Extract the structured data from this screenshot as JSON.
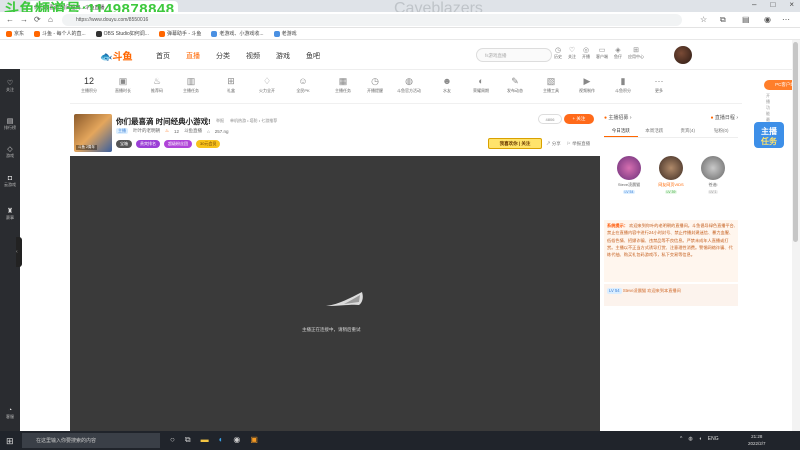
{
  "overlay": {
    "room_id": "斗鱼频道号:1149878848",
    "game_name": "Caveblazers"
  },
  "browser": {
    "tab_title": "你们最喜滴 时间经典...斗鱼直播",
    "url": "https://www.douyu.com/8550016",
    "bookmarks": [
      "京东",
      "斗鱼 - 每个人的直...",
      "OBS Studio如何调...",
      "弹幕助手 - 斗鱼",
      "老游戏、小游戏收...",
      "老游戏"
    ]
  },
  "header": {
    "nav": [
      "首页",
      "直播",
      "分类",
      "视频",
      "游戏",
      "鱼吧"
    ],
    "active_nav": "直播",
    "search_placeholder": "fs游戏直播",
    "icons": [
      {
        "label": "历史",
        "icon": "history-icon"
      },
      {
        "label": "关注",
        "icon": "follow-icon"
      },
      {
        "label": "开播",
        "icon": "broadcast-icon"
      },
      {
        "label": "客户端",
        "icon": "client-icon"
      },
      {
        "label": "鱼仔",
        "icon": "fish-icon"
      },
      {
        "label": "应用中心",
        "icon": "app-center-icon"
      }
    ]
  },
  "sidebar": [
    {
      "label": "关注",
      "icon": "heart-icon"
    },
    {
      "label": "排行榜",
      "icon": "ranking-icon"
    },
    {
      "label": "游戏",
      "icon": "game-icon"
    },
    {
      "label": "云游戏",
      "icon": "cloud-game-icon"
    },
    {
      "label": "赛事",
      "icon": "trophy-icon"
    },
    {
      "label": "客服",
      "icon": "service-icon"
    }
  ],
  "category_bar": {
    "level_number": "12",
    "items": [
      {
        "label": "主播积分",
        "icon": "points-icon"
      },
      {
        "label": "直播时长",
        "icon": "duration-icon"
      },
      {
        "label": "推荐码",
        "icon": "recommend-icon"
      },
      {
        "label": "主播任务",
        "icon": "task-icon"
      },
      {
        "label": "礼盒",
        "icon": "gift-icon"
      },
      {
        "label": "火力全开",
        "icon": "fire-icon"
      },
      {
        "label": "全民PK",
        "icon": "pk-icon"
      },
      {
        "label": "主播任务",
        "icon": "mission-icon"
      },
      {
        "label": "开播提醒",
        "icon": "alarm-icon"
      },
      {
        "label": "斗鱼官方活动",
        "icon": "event-icon"
      },
      {
        "label": "水友",
        "icon": "fans-icon"
      },
      {
        "label": "荣耀周期",
        "icon": "honor-icon"
      },
      {
        "label": "发布动态",
        "icon": "post-icon"
      },
      {
        "label": "主播工具",
        "icon": "tools-icon"
      },
      {
        "label": "视频制作",
        "icon": "video-icon"
      },
      {
        "label": "斗鱼积分",
        "icon": "score-icon"
      },
      {
        "label": "更多",
        "icon": "more-icon"
      }
    ],
    "pc_button": "PC客户端",
    "pc_sub": "开播功能最全面"
  },
  "room": {
    "avatar_label": "斗鱼 2周年",
    "title": "你们最喜滴 时间经典小游戏!",
    "tags": [
      "举报",
      "单机热游 • 塔防 • 七游推荐"
    ],
    "host_tag": "主播",
    "host_name": "叶叶的老明朝",
    "hot": "12",
    "room_id_text": "斗鱼直播",
    "heat": "257.ng",
    "badges": [
      "宝箱",
      "贵宾排名",
      "超级粉丝团",
      "30元会员"
    ],
    "follow_count": "4806",
    "follow_label": "+ 关注",
    "banner": "我喜欢你 | 关注",
    "share": "分享",
    "report": "举报直播"
  },
  "player": {
    "message": "主播正在连接中，请稍后重试"
  },
  "right_panel": {
    "head_left": "主播招募",
    "head_right": "直播日程",
    "tabs": [
      "今日活跃",
      "本周活跃",
      "贵宾(4)",
      "钻粉(0)"
    ],
    "ranks": [
      {
        "name": "Steve凌晨猫",
        "level": "LV 54"
      },
      {
        "name": "网友网页VIDS",
        "level": "LV 39"
      },
      {
        "name": "苍迪i",
        "level": "LV 1"
      }
    ],
    "system_title": "系统提示：",
    "system_text": "欢迎来到你叶的老明朝的直播间。斗鱼倡导绿色直播平台,禁止在直播内容中进行24小时封号、禁止传播封建迷信、暴力血腥、低俗色情、招嫖诈骗、违禁品等不良信息。严禁未成年人直播或打赏。主播以不正当方式诱导打赏、注意理性消费。警惕网络诈骗、代练代抽、购买礼包码游戏币，私下交易等信息。",
    "welcome_level": "LV 54",
    "welcome_name": "Steve凌晨猫",
    "welcome_text": "欢迎来到本直播间"
  },
  "taskbar": {
    "search_placeholder": "在这里输入你要搜索的内容",
    "time": "21:28",
    "date": "2022/2/7",
    "lang": "ENG"
  }
}
